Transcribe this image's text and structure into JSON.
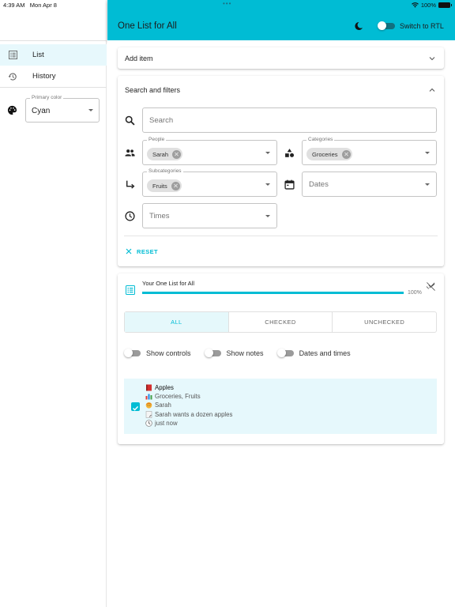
{
  "status_bar": {
    "time": "4:39 AM",
    "date": "Mon Apr 8",
    "battery": "100%"
  },
  "app_bar": {
    "title": "One List for All",
    "rtl_switch_label": "Switch to RTL",
    "rtl_enabled": false,
    "dark_mode_icon": "moon-icon"
  },
  "sidebar": {
    "items": [
      {
        "label": "List",
        "icon": "list-icon",
        "active": true
      },
      {
        "label": "History",
        "icon": "history-icon",
        "active": false
      }
    ],
    "primary_color": {
      "label": "Primary color",
      "value": "Cyan"
    }
  },
  "add_item": {
    "title": "Add item",
    "expanded": false
  },
  "filters": {
    "title": "Search and filters",
    "expanded": true,
    "search": {
      "placeholder": "Search",
      "value": ""
    },
    "people": {
      "label": "People",
      "chips": [
        "Sarah"
      ]
    },
    "categories": {
      "label": "Categories",
      "chips": [
        "Groceries"
      ]
    },
    "subcategories": {
      "label": "Subcategories",
      "chips": [
        "Fruits"
      ]
    },
    "dates": {
      "placeholder": "Dates"
    },
    "times": {
      "placeholder": "Times"
    },
    "reset_label": "RESET"
  },
  "list": {
    "title": "Your One List for All",
    "progress_percent": 100,
    "progress_label": "100%",
    "tabs": [
      {
        "label": "ALL",
        "active": true
      },
      {
        "label": "CHECKED",
        "active": false
      },
      {
        "label": "UNCHECKED",
        "active": false
      }
    ],
    "toggles": [
      {
        "label": "Show controls",
        "on": false
      },
      {
        "label": "Show notes",
        "on": false
      },
      {
        "label": "Dates and times",
        "on": false
      }
    ],
    "items": [
      {
        "checked": true,
        "name": "Apples",
        "categories": "Groceries, Fruits",
        "person": "Sarah",
        "note": "Sarah wants a dozen apples",
        "time": "just now"
      }
    ]
  },
  "colors": {
    "primary": "#00bcd4",
    "primary_dark": "#12707f",
    "active_bg": "#e6f8fc"
  }
}
